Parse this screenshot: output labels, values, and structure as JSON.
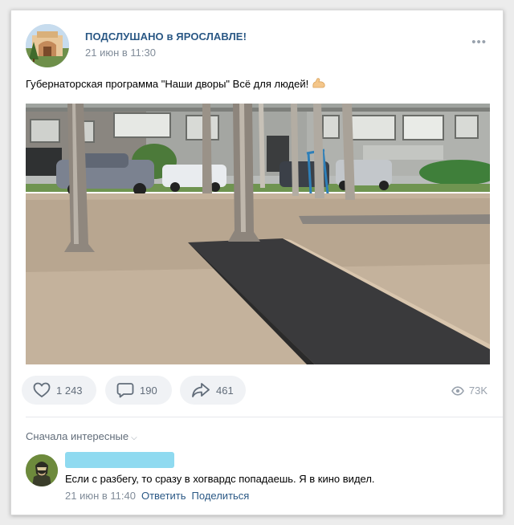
{
  "post": {
    "group_name": "ПОДСЛУШАНО в ЯРОСЛАВЛЕ!",
    "date": "21 июн в 11:30",
    "more_icon": "more-dots-icon",
    "text": "Губернаторская программа \"Наши дворы\" Всё для людей!",
    "emoji_icon": "flexed-biceps-icon"
  },
  "actions": {
    "likes": "1 243",
    "comments": "190",
    "shares": "461",
    "views": "73K"
  },
  "comments": {
    "sort_label": "Сначала интересные",
    "items": [
      {
        "text": "Если с разбегу, то сразу в хогвардс попадаешь. Я в кино видел.",
        "date": "21 июн в 11:40",
        "reply": "Ответить",
        "share": "Поделиться"
      }
    ]
  },
  "colors": {
    "link": "#2a5885",
    "secondary": "#818c99",
    "button_bg": "#f0f2f5",
    "redaction": "#8fdaf0"
  }
}
